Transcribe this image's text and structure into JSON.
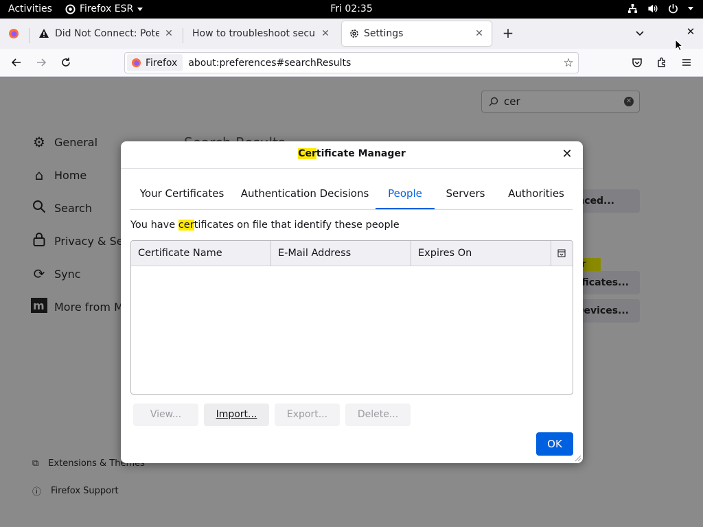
{
  "topbar": {
    "activities": "Activities",
    "app_name": "Firefox ESR",
    "clock": "Fri 02:35"
  },
  "tabs": [
    {
      "title": "Did Not Connect: Potential Security Issue"
    },
    {
      "title": "How to troubleshoot security error codes"
    },
    {
      "title": "Settings"
    }
  ],
  "navbar": {
    "identity_label": "Firefox",
    "url": "about:preferences#searchResults"
  },
  "settings": {
    "search_value": "cer",
    "results_heading": "Search Results",
    "categories": [
      {
        "label": "General",
        "icon": "gear-icon"
      },
      {
        "label": "Home",
        "icon": "home-icon"
      },
      {
        "label": "Search",
        "icon": "search-icon"
      },
      {
        "label": "Privacy & Security",
        "icon": "lock-icon"
      },
      {
        "label": "Sync",
        "icon": "sync-icon"
      },
      {
        "label": "More from Mozilla",
        "icon": "mozilla-icon"
      }
    ],
    "footer_links": [
      {
        "label": "Extensions & Themes",
        "icon": "puzzle-icon"
      },
      {
        "label": "Firefox Support",
        "icon": "help-icon"
      }
    ],
    "bg_buttons": {
      "advanced": "Advanced...",
      "highlight": "er",
      "view_certs": "View Certificates...",
      "security_devices": "Security Devices..."
    }
  },
  "dialog": {
    "title_highlight": "Cer",
    "title_rest": "tificate Manager",
    "tabs": [
      {
        "label": "Your Certificates"
      },
      {
        "label": "Authentication Decisions"
      },
      {
        "label": "People"
      },
      {
        "label": "Servers"
      },
      {
        "label": "Authorities"
      }
    ],
    "active_tab": "People",
    "intro_before": "You have ",
    "intro_highlight": "cer",
    "intro_after": "tificates on file that identify these people",
    "columns": [
      "Certificate Name",
      "E-Mail Address",
      "Expires On"
    ],
    "buttons": {
      "view": "View...",
      "import": "Import...",
      "export": "Export...",
      "delete": "Delete..."
    },
    "ok": "OK"
  },
  "colors": {
    "accent": "#0061e0",
    "highlight": "#ffe900"
  }
}
